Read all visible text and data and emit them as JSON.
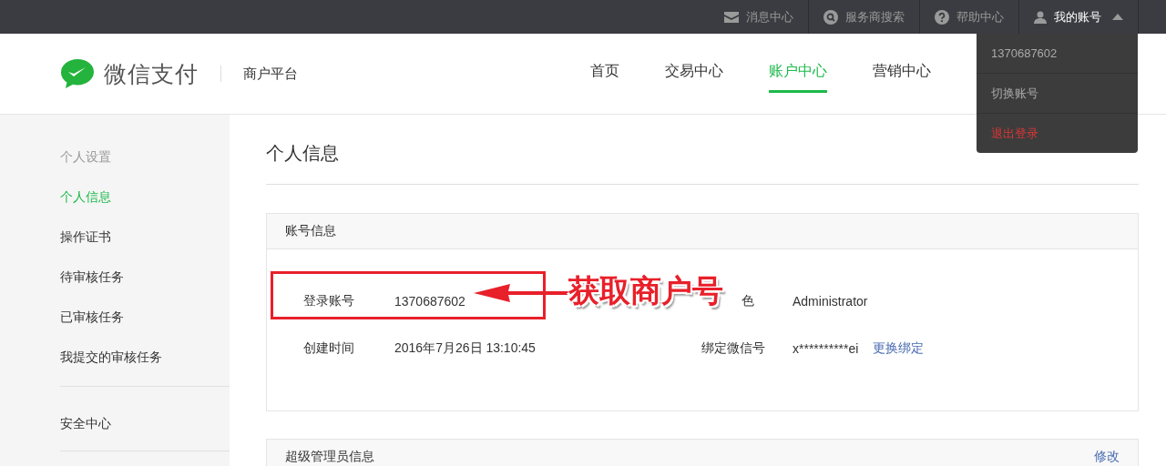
{
  "top_bar": {
    "links": [
      {
        "kind": "mail",
        "label": "消息中心"
      },
      {
        "kind": "search",
        "label": "服务商搜索"
      },
      {
        "kind": "help",
        "label": "帮助中心"
      }
    ],
    "account": {
      "label": "我的账号",
      "expanded": true
    }
  },
  "account_menu": [
    {
      "kind": "info",
      "label": "1370687602"
    },
    {
      "kind": "item",
      "label": "切换账号"
    },
    {
      "kind": "danger",
      "label": "退出登录"
    }
  ],
  "header": {
    "brand": "微信支付",
    "subtitle": "商户平台",
    "nav": [
      {
        "label": "首页",
        "selected": false
      },
      {
        "label": "交易中心",
        "selected": false
      },
      {
        "label": "账户中心",
        "selected": true
      },
      {
        "label": "营销中心",
        "selected": false
      }
    ]
  },
  "sidebar": {
    "groups": [
      {
        "heading": "个人设置",
        "items": [
          {
            "label": "个人信息",
            "selected": true
          },
          {
            "label": "操作证书",
            "selected": false
          },
          {
            "label": "待审核任务",
            "selected": false
          },
          {
            "label": "已审核任务",
            "selected": false
          },
          {
            "label": "我提交的审核任务",
            "selected": false
          }
        ]
      },
      {
        "items": [
          {
            "label": "安全中心",
            "selected": false
          }
        ]
      }
    ]
  },
  "page_title": "个人信息",
  "panels": [
    {
      "title": "账号信息",
      "rows": [
        [
          {
            "label": "登录账号",
            "value": "1370687602"
          },
          {
            "label": "色",
            "value": "Administrator"
          }
        ],
        [
          {
            "label": "创建时间",
            "value": "2016年7月26日 13:10:45"
          },
          {
            "label": "绑定微信号",
            "value": "x**********ei",
            "link": "更换绑定"
          }
        ]
      ]
    },
    {
      "title": "超级管理员信息",
      "action": "修改"
    }
  ],
  "annotation": {
    "callout": "获取商户号"
  }
}
